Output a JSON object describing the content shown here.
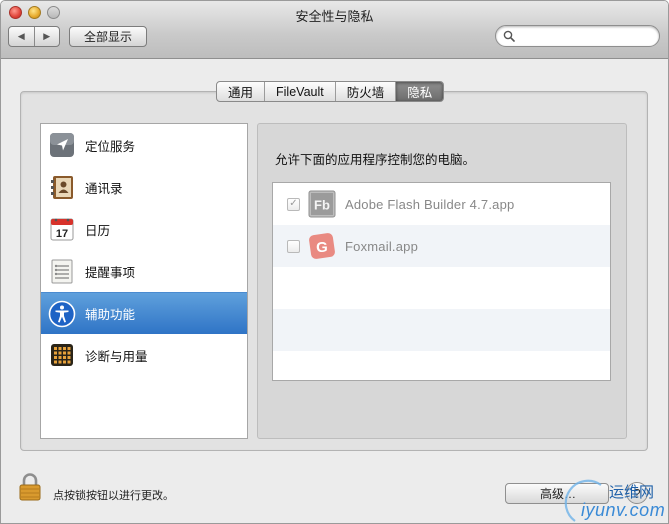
{
  "window": {
    "title": "安全性与隐私",
    "nav_back": "◀",
    "nav_forward": "▶",
    "show_all": "全部显示",
    "search_placeholder": ""
  },
  "tabs": [
    {
      "label": "通用",
      "active": false
    },
    {
      "label": "FileVault",
      "active": false
    },
    {
      "label": "防火墙",
      "active": false
    },
    {
      "label": "隐私",
      "active": true
    }
  ],
  "sidebar": {
    "items": [
      {
        "label": "定位服务",
        "icon": "location-arrow-icon",
        "selected": false
      },
      {
        "label": "通讯录",
        "icon": "contacts-icon",
        "selected": false
      },
      {
        "label": "日历",
        "icon": "calendar-icon",
        "selected": false,
        "calendar_day": "17"
      },
      {
        "label": "提醒事项",
        "icon": "reminders-icon",
        "selected": false
      },
      {
        "label": "辅助功能",
        "icon": "accessibility-icon",
        "selected": true
      },
      {
        "label": "诊断与用量",
        "icon": "diagnostics-icon",
        "selected": false
      }
    ]
  },
  "main": {
    "allow_text": "允许下面的应用程序控制您的电脑。",
    "apps": [
      {
        "name": "Adobe Flash Builder 4.7.app",
        "checked": true,
        "icon": "flash-builder-icon",
        "icon_text": "Fb"
      },
      {
        "name": "Foxmail.app",
        "checked": false,
        "icon": "foxmail-icon",
        "icon_text": "G"
      }
    ]
  },
  "footer": {
    "lock_text": "点按锁按钮以进行更改。",
    "advanced_label": "高级…",
    "help_label": "?"
  },
  "watermark": {
    "top": "运维网",
    "bottom": "iyunv.com"
  },
  "colors": {
    "selection": "#2f74c6",
    "window_bg": "#ececec",
    "pane_bg": "#e2e2e2"
  }
}
